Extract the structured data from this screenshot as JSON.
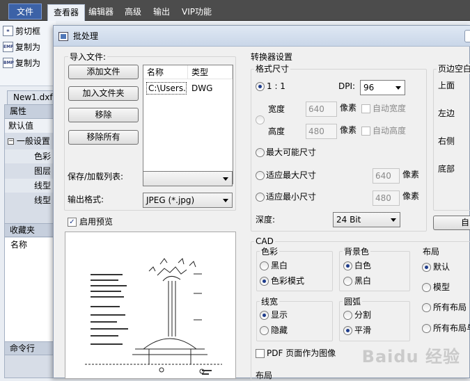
{
  "menubar": {
    "items": [
      "文件",
      "查看器",
      "编辑器",
      "高级",
      "输出",
      "VIP功能"
    ],
    "active": "查看器"
  },
  "ribbon": {
    "items": [
      {
        "label": "剪切框",
        "icon": "crop-frame-icon"
      },
      {
        "label": "复制为",
        "icon": "emf-copy-icon",
        "badge": "EMF"
      },
      {
        "label": "复制为",
        "icon": "bmp-copy-icon",
        "badge": "BMP"
      }
    ]
  },
  "doc_tab": "New1.dxf",
  "left_panel": {
    "properties_header": "属性",
    "default_value": "默认值",
    "general_settings": "一般设置",
    "tree_items": [
      "色彩",
      "图层",
      "线型",
      "线型"
    ],
    "favorites_header": "收藏夹",
    "name_header": "名称",
    "command_header": "命令行"
  },
  "dialog": {
    "title": "批处理",
    "import": {
      "group_title": "导入文件:",
      "add_file": "添加文件",
      "add_folder": "加入文件夹",
      "remove": "移除",
      "remove_all": "移除所有",
      "list_headers": {
        "name": "名称",
        "type": "类型"
      },
      "files": [
        {
          "name": "C:\\Users...",
          "type": "DWG"
        }
      ]
    },
    "save_load_list_label": "保存/加载列表:",
    "save_load_list_value": "",
    "output_format_label": "输出格式:",
    "output_format_value": "JPEG (*.jpg)",
    "enable_preview_label": "启用预览",
    "enable_preview_checked": true,
    "converter": {
      "group_title": "转换器设置",
      "format_size": {
        "group_title": "格式尺寸",
        "ratio_label": "1 : 1",
        "dpi_label": "DPI:",
        "dpi_value": "96",
        "width_label": "宽度",
        "width_value": "640",
        "width_unit": "像素",
        "auto_width": "自动宽度",
        "height_label": "高度",
        "height_value": "480",
        "height_unit": "像素",
        "auto_height": "自动高度",
        "max_size": "最大可能尺寸",
        "fit_max": "适应最大尺寸",
        "fit_max_value": "640",
        "fit_max_unit": "像素",
        "fit_min": "适应最小尺寸",
        "fit_min_value": "480",
        "fit_min_unit": "像素",
        "depth_label": "深度:",
        "depth_value": "24 Bit"
      },
      "margins": {
        "group_title": "页边空白",
        "top": "上面",
        "left": "左边",
        "right": "右侧",
        "bottom": "底部",
        "button_partial": "自"
      },
      "cad": {
        "group_title": "CAD",
        "color": {
          "title": "色彩",
          "options": [
            "黑白",
            "色彩模式"
          ],
          "selected": 1
        },
        "background": {
          "title": "背景色",
          "options": [
            "白色",
            "黑白"
          ],
          "selected": 0
        },
        "layout": {
          "title": "布局",
          "options": [
            "默认",
            "模型",
            "所有布局",
            "所有布局与"
          ],
          "selected": 0
        },
        "line_width": {
          "title": "线宽",
          "options": [
            "显示",
            "隐藏"
          ],
          "selected": 0
        },
        "arc": {
          "title": "圆弧",
          "options": [
            "分割",
            "平滑"
          ],
          "selected": 1
        },
        "pdf_page_as_image": "PDF 页面作为图像",
        "bottom_partial": "布局"
      }
    }
  },
  "watermark": "Baidu 经验"
}
